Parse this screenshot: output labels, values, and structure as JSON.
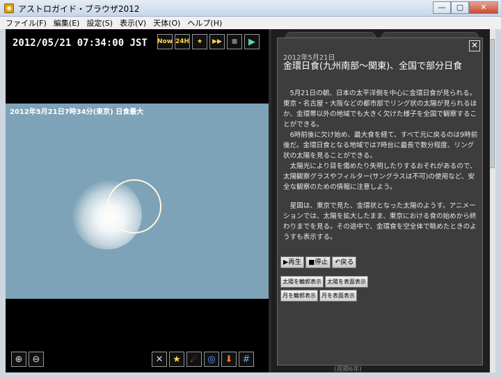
{
  "window": {
    "title": "アストロガイド・ブラウザ2012",
    "minimize": "—",
    "maximize": "▢",
    "close": "✕"
  },
  "menu": [
    "ファイル(F)",
    "編集(E)",
    "設定(S)",
    "表示(V)",
    "天体(O)",
    "ヘルプ(H)"
  ],
  "viewer": {
    "datetime": "2012/05/21  07:34:00  JST",
    "tools": [
      {
        "name": "now-button",
        "label": "Now"
      },
      {
        "name": "24h-button",
        "label": "24H"
      },
      {
        "name": "star-button",
        "label": "★"
      },
      {
        "name": "clock-button",
        "label": "▶▶"
      },
      {
        "name": "stop-button",
        "label": "■"
      },
      {
        "name": "play-button",
        "label": "▶"
      }
    ],
    "caption": "2012年5月21日7時34分(東京)  日食最大",
    "zoom_in": "⊕",
    "zoom_out": "⊖",
    "bottom_tools": [
      {
        "name": "crosshair-icon",
        "label": "✕",
        "style": ""
      },
      {
        "name": "star-icon",
        "label": "★",
        "style": "star"
      },
      {
        "name": "comet-icon",
        "label": "☄",
        "style": "orange"
      },
      {
        "name": "galaxy-icon",
        "label": "◎",
        "style": "blue"
      },
      {
        "name": "download-icon",
        "label": "⬇",
        "style": "orange"
      },
      {
        "name": "grid-icon",
        "label": "#",
        "style": "blue"
      }
    ]
  },
  "article": {
    "date": "2012年5月21日",
    "title": "金環日食(九州南部〜関東)、全国で部分日食",
    "paragraphs": [
      "5月21日の朝、日本の太平洋側を中心に金環日食が見られる。東京・名古屋・大阪などの都市部でリング状の太陽が見られるほか、金環帯以外の地域でも大きく欠けた様子を全国で観察することができる。",
      "6時前後に欠け始め、最大食を経て、すべて元に戻るのは9時前後だ。金環日食となる地域では7時台に最長で数分程度、リング状の太陽を見ることができる。",
      "太陽光により目を傷めたり失明したりするおそれがあるので、太陽観察グラスやフィルター(サングラスは不可)の使用など、安全な観察のための情報に注意しよう。",
      "星図は、東京で見た、金環状となった太陽のようす。アニメーションでは、太陽を拡大したまま、東京における食の始めから終わりまでを見る。その途中で、金環食を空全体で眺めたときのようすも表示する。"
    ],
    "controls": {
      "play": "▶再生",
      "stop": "■停止",
      "back": "↶戻る"
    },
    "options": {
      "sun_outline": "太陽を輪郭表示",
      "sun_surface": "太陽を表面表示",
      "moon_outline": "月を輪郭表示",
      "moon_surface": "月を表面表示"
    },
    "close": "✕"
  },
  "background_text": "(周期6年)"
}
